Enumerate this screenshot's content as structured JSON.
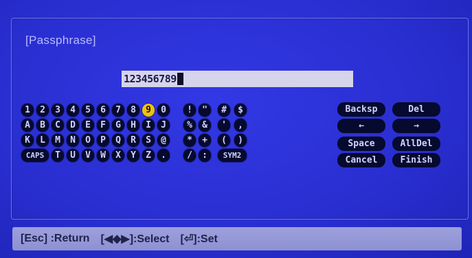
{
  "dialog": {
    "title": "[Passphrase]",
    "passphrase_value": "123456789"
  },
  "keyboard": {
    "selected_key": "9",
    "rows": [
      [
        "1",
        "2",
        "3",
        "4",
        "5",
        "6",
        "7",
        "8",
        "9",
        "0"
      ],
      [
        "A",
        "B",
        "C",
        "D",
        "E",
        "F",
        "G",
        "H",
        "I",
        "J"
      ],
      [
        "K",
        "L",
        "M",
        "N",
        "O",
        "P",
        "Q",
        "R",
        "S",
        "@"
      ],
      [
        "CAPS",
        "T",
        "U",
        "V",
        "W",
        "X",
        "Y",
        "Z",
        "."
      ]
    ],
    "symbols": [
      [
        "!",
        "\"",
        "#",
        "$"
      ],
      [
        "%",
        "&",
        "'",
        ","
      ],
      [
        "*",
        "+",
        "(",
        ")"
      ],
      [
        "/",
        ":",
        "SYM2"
      ]
    ],
    "controls": {
      "backsp": "Backsp",
      "del": "Del",
      "left": "←",
      "right": "→",
      "space": "Space",
      "alldel": "AllDel",
      "cancel": "Cancel",
      "finish": "Finish"
    }
  },
  "statusbar": {
    "esc": "[Esc] :Return",
    "select": "[◀◆▶]:Select",
    "set": "[⏎]:Set"
  },
  "colors": {
    "background": "#2b2fd6",
    "key": "#060a2e",
    "key_text": "#cfd3ff",
    "selected": "#f0c20c",
    "input_bg": "#d6d4ea"
  }
}
